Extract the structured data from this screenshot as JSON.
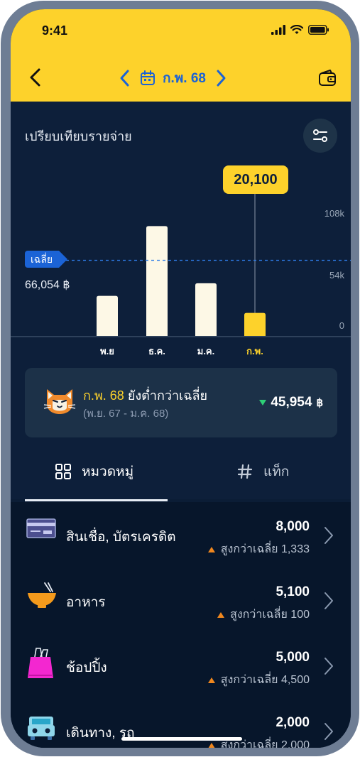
{
  "status": {
    "time": "9:41"
  },
  "header": {
    "month_label": "ก.พ. 68"
  },
  "panel": {
    "title": "เปรียบเทียบรายจ่าย",
    "avg_tag": "เฉลี่ย",
    "avg_value": "66,054 ฿",
    "tooltip": "20,100"
  },
  "chart_data": {
    "type": "bar",
    "categories": [
      "พ.ย",
      "ธ.ค.",
      "ม.ค.",
      "ก.พ."
    ],
    "values": [
      35000,
      96000,
      46000,
      20100
    ],
    "average": 66054,
    "ylim": [
      0,
      108000
    ],
    "yticks": [
      "108k",
      "54k",
      "0"
    ],
    "highlight_index": 3,
    "colors": {
      "bar": "#fdf8e6",
      "highlight": "#fdd22b",
      "avg_line": "#2f7de8"
    }
  },
  "summary": {
    "month": "ก.พ. 68",
    "text": "ยังต่ำกว่าเฉลี่ย",
    "range": "(พ.ย. 67 - ม.ค. 68)",
    "diff": "45,954",
    "currency": "฿"
  },
  "tabs": [
    {
      "label": "หมวดหมู่",
      "icon": "grid-icon"
    },
    {
      "label": "แท็ก",
      "icon": "hash-icon"
    }
  ],
  "categories": [
    {
      "name": "สินเชื่อ, บัตรเครดิต",
      "amount": "8,000",
      "note": "สูงกว่าเฉลี่ย 1,333",
      "icon": "credit-card-icon"
    },
    {
      "name": "อาหาร",
      "amount": "5,100",
      "note": "สูงกว่าเฉลี่ย 100",
      "icon": "food-bowl-icon"
    },
    {
      "name": "ช้อปปิ้ง",
      "amount": "5,000",
      "note": "สูงกว่าเฉลี่ย 4,500",
      "icon": "shopping-bag-icon"
    },
    {
      "name": "เดินทาง, รถ",
      "amount": "2,000",
      "note": "สูงกว่าเฉลี่ย 2,000",
      "icon": "car-icon"
    }
  ],
  "colors": {
    "accent": "#fdd22b",
    "primary_blue": "#1b63d6",
    "background": "#0d1f3a",
    "up_arrow": "#f0871e",
    "down_arrow": "#2ecf76"
  }
}
